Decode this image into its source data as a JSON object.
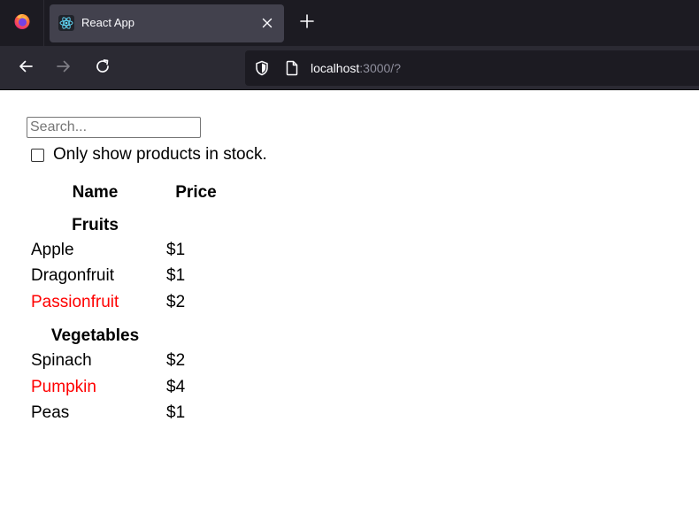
{
  "browser": {
    "tab_title": "React App",
    "url_host": "localhost",
    "url_rest": ":3000/?"
  },
  "search": {
    "placeholder": "Search...",
    "value": ""
  },
  "stock_filter": {
    "label": "Only show products in stock.",
    "checked": false
  },
  "table": {
    "headers": {
      "name": "Name",
      "price": "Price"
    },
    "categories": [
      {
        "name": "Fruits",
        "products": [
          {
            "name": "Apple",
            "price": "$1",
            "stocked": true
          },
          {
            "name": "Dragonfruit",
            "price": "$1",
            "stocked": true
          },
          {
            "name": "Passionfruit",
            "price": "$2",
            "stocked": false
          }
        ]
      },
      {
        "name": "Vegetables",
        "products": [
          {
            "name": "Spinach",
            "price": "$2",
            "stocked": true
          },
          {
            "name": "Pumpkin",
            "price": "$4",
            "stocked": false
          },
          {
            "name": "Peas",
            "price": "$1",
            "stocked": true
          }
        ]
      }
    ]
  },
  "colors": {
    "out_of_stock": "#ff0000",
    "in_stock": "#000000",
    "tab_bar": "#1c1b22",
    "nav_bar": "#2b2a33",
    "active_tab": "#42414d"
  },
  "icons": {
    "app_menu": "firefox-logo-icon",
    "favicon": "react-logo-icon",
    "tab_close": "close-icon",
    "new_tab": "plus-icon",
    "back": "back-arrow-icon",
    "forward": "forward-arrow-icon",
    "reload": "reload-icon",
    "tracking": "shield-icon",
    "page": "page-icon"
  }
}
